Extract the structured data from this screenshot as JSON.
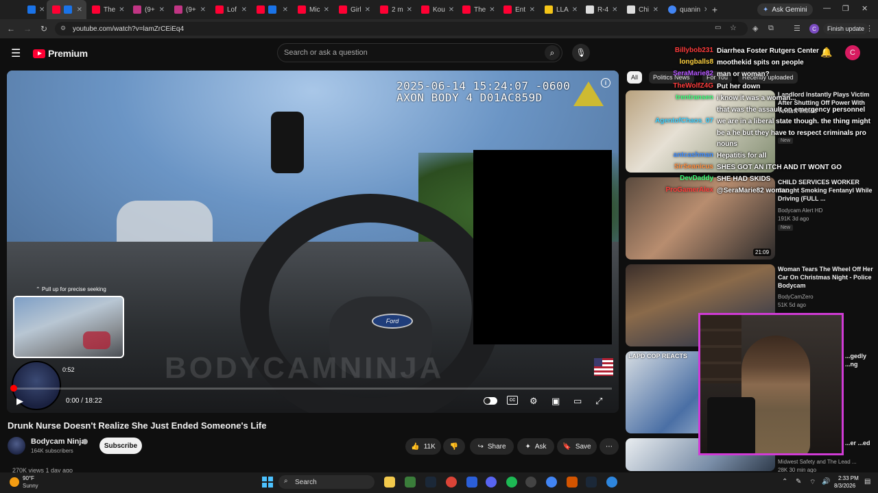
{
  "browser": {
    "tabs": [
      {
        "label": "",
        "color": "#ffffff"
      },
      {
        "label": "",
        "color": "#1a73e8"
      },
      {
        "label": "",
        "color": "#ff0033"
      },
      {
        "label": "The",
        "color": "#ff0033"
      },
      {
        "label": "(9+",
        "color": "#c13584"
      },
      {
        "label": "(9+",
        "color": "#c13584"
      },
      {
        "label": "Lof",
        "color": "#ff0033"
      },
      {
        "label": "",
        "color": "#ff0033"
      },
      {
        "label": "Mic",
        "color": "#ff0033"
      },
      {
        "label": "Girl",
        "color": "#ff0033"
      },
      {
        "label": "2 m",
        "color": "#ff0033"
      },
      {
        "label": "Kou",
        "color": "#ff0033"
      },
      {
        "label": "The",
        "color": "#ff0033"
      },
      {
        "label": "Ent",
        "color": "#ff0033"
      },
      {
        "label": "LLA",
        "color": "#f5c518"
      },
      {
        "label": "R-4",
        "color": "#ffffff"
      },
      {
        "label": "Chi",
        "color": "#ffffff"
      },
      {
        "label": "quanin",
        "color": "#4285f4"
      }
    ],
    "ask_gemini": "Ask Gemini",
    "url": "youtube.com/watch?v=lamZrCEiEq4",
    "finish_update": "Finish update",
    "profile_initial": "C"
  },
  "youtube": {
    "logo_text": "Premium",
    "search_placeholder": "Search or ask a question",
    "avatar_initial": "C"
  },
  "player": {
    "timestamp_line1": "2025-06-14 15:24:07 -0600",
    "timestamp_line2": "AXON BODY 4 D01AC859D",
    "steering_badge": "Ford",
    "watermark": "BODYCAMNINJA",
    "seek_hint": "Pull up for precise seeking",
    "preview_time": "0:52",
    "time_display": "0:00 / 18:22",
    "progress_fraction": 0.0
  },
  "video": {
    "title": "Drunk Nurse Doesn't Realize She Just Ended Someone's Life",
    "channel": "Bodycam Ninja",
    "subscribers": "164K subscribers",
    "subscribe_label": "Subscribe",
    "likes": "11K",
    "share_label": "Share",
    "ask_label": "Ask",
    "save_label": "Save",
    "views_line": "270K views  1 day ago"
  },
  "chips": [
    "All",
    "Politics News",
    "For You",
    "Recently uploaded"
  ],
  "recommendations": [
    {
      "title": "Landlord Instantly Plays Victim After Shutting Off Power With Tenant Inside",
      "channel": "",
      "meta": "",
      "badge": "New",
      "duration": ""
    },
    {
      "title": "CHILD SERVICES WORKER Caught Smoking Fentanyl While Driving (FULL ...",
      "channel": "Bodycam Alert HD",
      "meta": "191K  3d ago",
      "badge": "New",
      "duration": "21:09"
    },
    {
      "title": "Woman Tears The Wheel Off Her Car On Christmas Night - Police Bodycam",
      "channel": "BodyCamZero",
      "meta": "51K  5d ago",
      "badge": "",
      "duration": ""
    },
    {
      "title": "...gedly ...ng",
      "channel": "",
      "meta": "",
      "badge": "",
      "duration": ""
    },
    {
      "title": "...er ...ed",
      "channel": "Midwest Safety  and The Lead ...",
      "meta": "28K  30 min ago",
      "badge": "",
      "duration": ""
    }
  ],
  "rec4_overlay": "LAPD COP REACTS",
  "chat": [
    {
      "user": "Billybob231",
      "user_color": "#ff3b3b",
      "msg": "Diarrhea Foster Rutgers Center"
    },
    {
      "user": "longballs8",
      "user_color": "#ffd23f",
      "msg": "moothekid spits on people"
    },
    {
      "user": "SeraMarie82",
      "user_color": "#b455ff",
      "msg": "man or woman?"
    },
    {
      "user": "TheWolfZ4G",
      "user_color": "#ff3b3b",
      "msg": "Put her down"
    },
    {
      "user": "trentransen",
      "user_color": "#3bff7a",
      "msg": "i know it was a woman..."
    },
    {
      "user": "",
      "user_color": "#3bd1ff",
      "msg": "that was the assault on emergency personnel"
    },
    {
      "user": "AgentofChaos_07",
      "user_color": "#3bd1ff",
      "msg": "we are in a liberal state though. the thing might"
    },
    {
      "user": "",
      "user_color": "#ffffff",
      "msg": "be a he but they have to respect criminals pro"
    },
    {
      "user": "",
      "user_color": "#ffffff",
      "msg": "nouns"
    },
    {
      "user": "antcashman",
      "user_color": "#3b8bff",
      "msg": "Hepatitis for all"
    },
    {
      "user": "SirSeanicus",
      "user_color": "#ff8b3b",
      "msg": "SHES GOT AN ITCH AND IT WONT GO"
    },
    {
      "user": "DevDaddy",
      "user_color": "#3bff7a",
      "msg": "SHE HAD SKIDS"
    },
    {
      "user": "ProGamerAlex",
      "user_color": "#ff3b3b",
      "msg": "@SeraMarie82 woman"
    }
  ],
  "taskbar": {
    "temp": "90°F",
    "condition": "Sunny",
    "search_label": "Search",
    "time": "2:33 PM",
    "date": "8/3/2026"
  }
}
